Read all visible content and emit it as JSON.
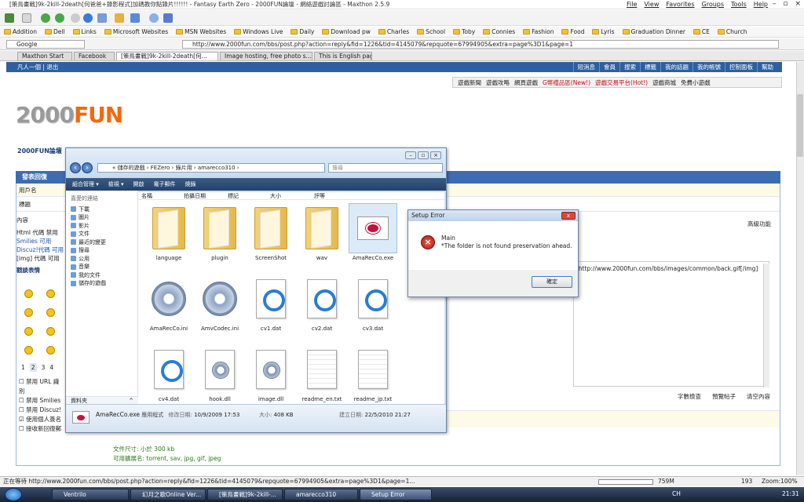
{
  "browser": {
    "title": "[策鳥畫戰]9k-2kill-2death[何爸爸+錄影程式]加碼教你點錄片!!!!!! - Fantasy Earth Zero - 2000FUN論壇 - 網絡遊戲討論區 - Maxthon 2.5.9",
    "menu": [
      "File",
      "View",
      "Favorites",
      "Groups",
      "Tools",
      "Help"
    ],
    "win_controls": [
      "–",
      "▫",
      "×"
    ],
    "favorites": [
      "Addition",
      "Dell",
      "Links",
      "Microsoft Websites",
      "MSN Websites",
      "Windows Live",
      "Daily",
      "Download pw",
      "Charles",
      "School",
      "Toby",
      "Connies",
      "Fashion",
      "Food",
      "Lyris",
      "Graduation Dinner",
      "CE",
      "Church"
    ],
    "search_placeholder": "Google",
    "url": "http://www.2000fun.com/bbs/post.php?action=reply&fid=1226&tid=4145079&repquote=67994905&extra=page%3D1&page=1",
    "tabs": [
      "Maxthon Start",
      "Facebook",
      "[策鳥畫戰]9k-2kill-2death[何...",
      "Image hosting, free photo s...",
      "This is English page"
    ]
  },
  "site": {
    "user_link": "凡人一個",
    "logout": "退出",
    "top_links": [
      "短消息",
      "會員",
      "搜索",
      "標籤",
      "我的話題",
      "我的帳號",
      "控制面板",
      "幫助"
    ],
    "game_links": [
      "遊戲新聞",
      "遊戲攻略",
      "網頁遊戲",
      "G幣禮品區(New!)",
      "遊戲交易平台(Hot!)",
      "遊戲商城",
      "免費小遊戲"
    ],
    "logo_a": "2000",
    "logo_b": "FUN",
    "forum_link": "2000FUN論壇",
    "post_header": "發表回復",
    "labels": {
      "username": "用戶名",
      "subject": "標題",
      "content": "內容",
      "html": "Html 代碼 禁用",
      "smilies": "Smilies 可用",
      "discuz": "Discuz!代碼 可用",
      "img": "[img] 代碼 可用",
      "smilies_head": "戳談表情"
    },
    "pages": [
      "1",
      "2",
      "3",
      "4"
    ],
    "options": [
      "禁用 URL 識別",
      "禁用 Smilies",
      "禁用 Discuz!",
      "使用個人簽名",
      "接收新回復郵"
    ],
    "advanced": "高級功能",
    "editor_text": "[http://www.2000fun.com/bbs/images/common/back.gif[/img]",
    "editor_actions": [
      "字數檢查",
      "預覽帖子",
      "清空內容"
    ],
    "attach_size": "文件尺寸: 小於 300 kb",
    "attach_ext": "可用擴展名: torrent, sav, jpg, gif, jpeg"
  },
  "explorer": {
    "breadcrumb": "« 儲存的遊戲 › FEZero › 錄片用 › amarecco310 ›",
    "search_placeholder": "搜尋",
    "commands": [
      "組合管理 ▾",
      "檢視 ▾",
      "開啟",
      "電子郵件",
      "燒錄"
    ],
    "nav_title": "喜愛的連結",
    "nav_items": [
      "下載",
      "圖片",
      "影片",
      "文件",
      "最近的變更",
      "搜尋",
      "公用",
      "音樂",
      "我的文件",
      "儲存的遊戲"
    ],
    "folders_label": "資料夾",
    "columns": [
      "名稱",
      "拍攝日期",
      "標記",
      "大小",
      "評等"
    ],
    "files": [
      {
        "name": "language",
        "type": "folder"
      },
      {
        "name": "plugin",
        "type": "folder"
      },
      {
        "name": "ScreenShot",
        "type": "folder"
      },
      {
        "name": "wav",
        "type": "folder"
      },
      {
        "name": "AmaRecCo.exe",
        "type": "exe",
        "selected": true
      },
      {
        "name": "AmaRecCo.ini",
        "type": "gear"
      },
      {
        "name": "AmvCodec.ini",
        "type": "gear"
      },
      {
        "name": "cv1.dat",
        "type": "quick"
      },
      {
        "name": "cv2.dat",
        "type": "quick"
      },
      {
        "name": "cv3.dat",
        "type": "quick"
      },
      {
        "name": "cv4.dat",
        "type": "quick"
      },
      {
        "name": "hook.dll",
        "type": "dll"
      },
      {
        "name": "image.dll",
        "type": "dll"
      },
      {
        "name": "readme_en.txt",
        "type": "txt"
      },
      {
        "name": "readme_jp.txt",
        "type": "txt"
      }
    ],
    "status": {
      "name": "AmaRecCo.exe",
      "kind": "應用程式",
      "modified_label": "修改日期:",
      "modified": "10/9/2009 17:53",
      "size_label": "大小:",
      "size": "408 KB",
      "created_label": "建立日期:",
      "created": "22/5/2010 21:27"
    }
  },
  "dialog": {
    "title": "Setup Error",
    "close": "x",
    "heading": "Main",
    "message": "*The folder is not found preservation ahead.",
    "ok": "確定"
  },
  "statusbar": {
    "text": "正在等待 http://www.2000fun.com/bbs/post.php?action=reply&fid=1226&tid=4145079&repquote=67994905&extra=page%3D1&page=1...",
    "mem": "759M",
    "count": "193",
    "zoom": "Zoom:100%"
  },
  "taskbar": {
    "tasks": [
      "Ventrilo",
      "幻月之歌Online Ver...",
      "[策鳥畫戰]9k-2kill-...",
      "amarecco310",
      "Setup Error"
    ],
    "lang": "CH",
    "time": "21:31"
  }
}
